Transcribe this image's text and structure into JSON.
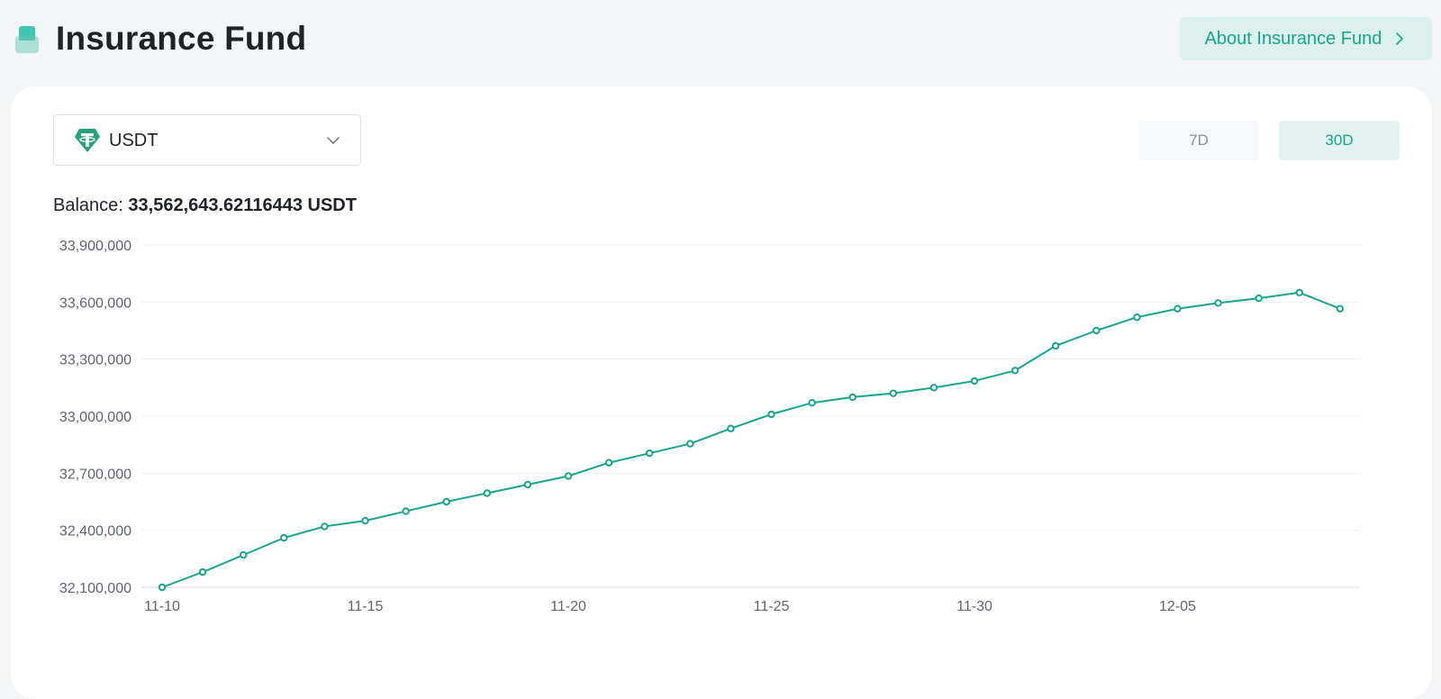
{
  "header": {
    "title": "Insurance Fund",
    "icon": "insurance-fund-icon",
    "about_button_label": "About Insurance Fund"
  },
  "coin_select": {
    "selected": "USDT",
    "icon": "tether-icon"
  },
  "range_tabs": [
    {
      "label": "7D",
      "active": false
    },
    {
      "label": "30D",
      "active": true
    }
  ],
  "balance": {
    "label": "Balance:",
    "value": "33,562,643.62116443",
    "unit": "USDT"
  },
  "colors": {
    "accent": "#17a58b",
    "accent_light": "#ddf1ec"
  },
  "chart_data": {
    "type": "line",
    "title": "",
    "xlabel": "",
    "ylabel": "",
    "ylim": [
      32100000,
      33900000
    ],
    "yticks": [
      "33,900,000",
      "33,600,000",
      "33,300,000",
      "33,000,000",
      "32,700,000",
      "32,400,000",
      "32,100,000"
    ],
    "ytick_values": [
      33900000,
      33600000,
      33300000,
      33000000,
      32700000,
      32400000,
      32100000
    ],
    "xtick_labels": [
      "11-10",
      "11-15",
      "11-20",
      "11-25",
      "11-30",
      "12-05"
    ],
    "x": [
      "11-10",
      "11-11",
      "11-12",
      "11-13",
      "11-14",
      "11-15",
      "11-16",
      "11-17",
      "11-18",
      "11-19",
      "11-20",
      "11-21",
      "11-22",
      "11-23",
      "11-24",
      "11-25",
      "11-26",
      "11-27",
      "11-28",
      "11-29",
      "11-30",
      "12-01",
      "12-02",
      "12-03",
      "12-04",
      "12-05",
      "12-06",
      "12-07",
      "12-08",
      "12-09"
    ],
    "series": [
      {
        "values": [
          32100000,
          32180000,
          32270000,
          32360000,
          32420000,
          32450000,
          32500000,
          32550000,
          32595000,
          32640000,
          32685000,
          32755000,
          32805000,
          32855000,
          32935000,
          33010000,
          33070000,
          33100000,
          33120000,
          33150000,
          33185000,
          33240000,
          33370000,
          33450000,
          33520000,
          33565000,
          33595000,
          33620000,
          33650000,
          33565000
        ]
      }
    ],
    "grid": true
  }
}
